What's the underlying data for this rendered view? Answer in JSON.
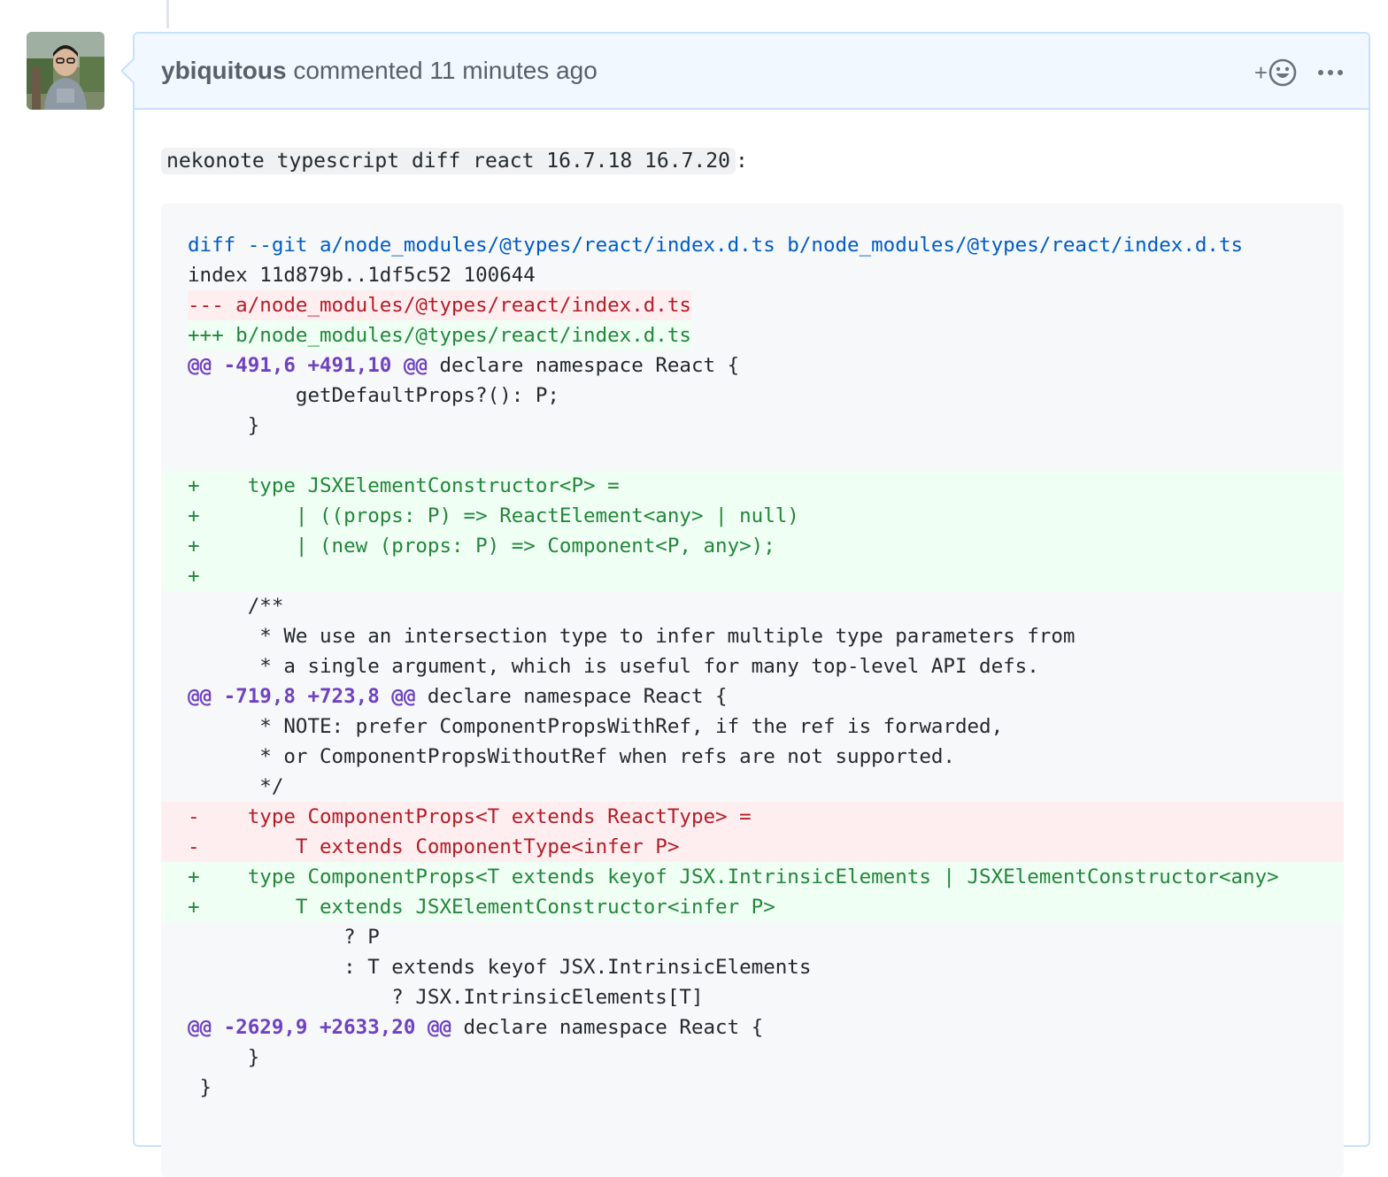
{
  "comment": {
    "author": "ybiquitous",
    "action": "commented",
    "time": "11 minutes ago",
    "reaction_plus": "+",
    "command": "nekonote typescript diff react 16.7.18 16.7.20",
    "command_suffix": ":"
  },
  "diff_lines": [
    {
      "type": "meta",
      "text": "diff --git a/node_modules/@types/react/index.d.ts b/node_modules/@types/react/index.d.ts"
    },
    {
      "type": "context",
      "text": "index 11d879b..1df5c52 100644"
    },
    {
      "type": "del-hdr",
      "text": "--- a/node_modules/@types/react/index.d.ts"
    },
    {
      "type": "add-hdr",
      "text": "+++ b/node_modules/@types/react/index.d.ts"
    },
    {
      "type": "hunk",
      "range": "@@ -491,6 +491,10 @@",
      "text": " declare namespace React {"
    },
    {
      "type": "context",
      "text": "         getDefaultProps?(): P;"
    },
    {
      "type": "context",
      "text": "     }"
    },
    {
      "type": "context",
      "text": " "
    },
    {
      "type": "add",
      "text": "+    type JSXElementConstructor<P> ="
    },
    {
      "type": "add",
      "text": "+        | ((props: P) => ReactElement<any> | null)"
    },
    {
      "type": "add",
      "text": "+        | (new (props: P) => Component<P, any>);"
    },
    {
      "type": "add",
      "text": "+"
    },
    {
      "type": "context",
      "text": "     /**"
    },
    {
      "type": "context",
      "text": "      * We use an intersection type to infer multiple type parameters from"
    },
    {
      "type": "context",
      "text": "      * a single argument, which is useful for many top-level API defs."
    },
    {
      "type": "hunk",
      "range": "@@ -719,8 +723,8 @@",
      "text": " declare namespace React {"
    },
    {
      "type": "context",
      "text": "      * NOTE: prefer ComponentPropsWithRef, if the ref is forwarded,"
    },
    {
      "type": "context",
      "text": "      * or ComponentPropsWithoutRef when refs are not supported."
    },
    {
      "type": "context",
      "text": "      */"
    },
    {
      "type": "del",
      "text": "-    type ComponentProps<T extends ReactType> ="
    },
    {
      "type": "del",
      "text": "-        T extends ComponentType<infer P>"
    },
    {
      "type": "add",
      "text": "+    type ComponentProps<T extends keyof JSX.IntrinsicElements | JSXElementConstructor<any>"
    },
    {
      "type": "add",
      "text": "+        T extends JSXElementConstructor<infer P>"
    },
    {
      "type": "context",
      "text": "             ? P"
    },
    {
      "type": "context",
      "text": "             : T extends keyof JSX.IntrinsicElements"
    },
    {
      "type": "context",
      "text": "                 ? JSX.IntrinsicElements[T]"
    },
    {
      "type": "hunk",
      "range": "@@ -2629,9 +2633,20 @@",
      "text": " declare namespace React {"
    },
    {
      "type": "context",
      "text": "     }"
    },
    {
      "type": "context",
      "text": " }"
    }
  ]
}
